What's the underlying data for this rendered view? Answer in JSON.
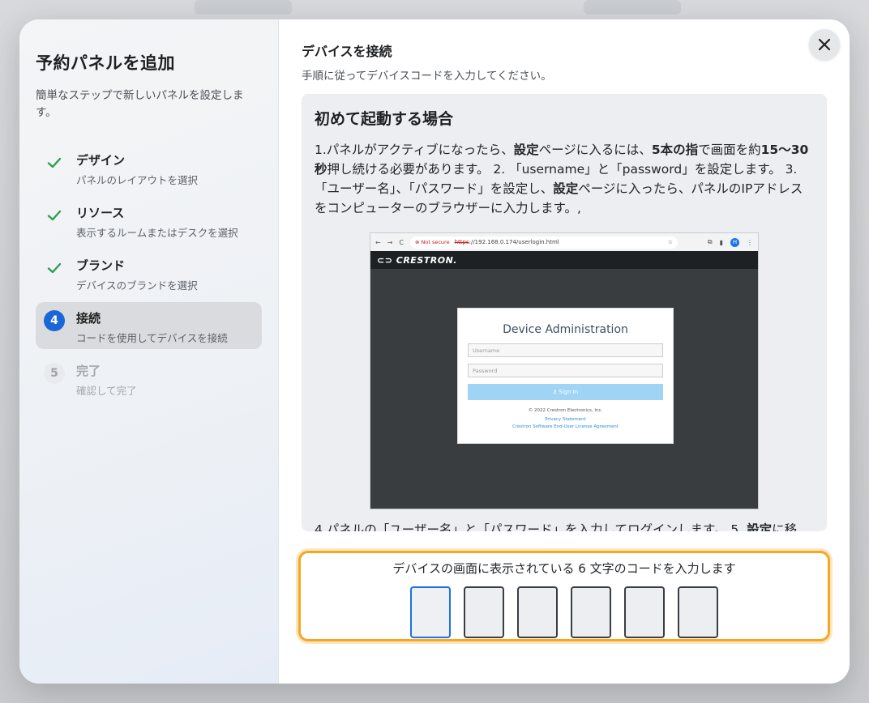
{
  "modal": {
    "sidebar": {
      "title": "予約パネルを追加",
      "subtitle": "簡単なステップで新しいパネルを設定します。",
      "steps": [
        {
          "name": "デザイン",
          "desc": "パネルのレイアウトを選択",
          "status": "done",
          "number": "1"
        },
        {
          "name": "リソース",
          "desc": "表示するルームまたはデスクを選択",
          "status": "done",
          "number": "2"
        },
        {
          "name": "ブランド",
          "desc": "デバイスのブランドを選択",
          "status": "done",
          "number": "3"
        },
        {
          "name": "接続",
          "desc": "コードを使用してデバイスを接続",
          "status": "current",
          "number": "4"
        },
        {
          "name": "完了",
          "desc": "確認して完了",
          "status": "pending",
          "number": "5"
        }
      ]
    },
    "main": {
      "title": "デバイスを接続",
      "subtitle": "手順に従ってデバイスコードを入力してください。",
      "close_icon": "close-icon",
      "instructions": {
        "heading": "初めて起動する場合",
        "p1_a": "1.パネルがアクティブになったら、",
        "p1_b": "設定",
        "p1_c": "ページに入るには、",
        "p1_d": "5本の指",
        "p1_e": "で画面を約",
        "p1_f": "15〜30秒",
        "p1_g": "押し続ける必要があります。 2. 「username」と「password」を設定します。 3. 「ユーザー名」、「パスワード」を設定し、",
        "p1_h": "設定",
        "p1_i": "ページに入ったら、パネルのIPアドレスをコンピューターのブラウザーに入力します。,",
        "p2_a": "4.パネルの「ユーザー名」と「パスワード」を入力してログインします。 5. ",
        "p2_b": "設定",
        "p2_c": "に移"
      },
      "screenshot": {
        "not_secure": "Not secure",
        "url_scheme": "https",
        "url_rest": "://192.168.0.174/userlogin.html",
        "brand": "CRESTRON.",
        "avatar": "H",
        "panel_title": "Device Administration",
        "username_placeholder": "Username",
        "password_placeholder": "Password",
        "sign_in": "Sign In",
        "copyright": "© 2022 Crestron Electronics, Inc.",
        "privacy": "Privacy Statement",
        "eula": "Crestron Software End-User License Agreement"
      },
      "code": {
        "prompt": "デバイスの画面に表示されている 6 文字のコードを入力します",
        "cells": [
          "",
          "",
          "",
          "",
          "",
          ""
        ]
      }
    }
  },
  "colors": {
    "accent_blue": "#1a66d6",
    "check_green": "#2e9e4f",
    "highlight_orange": "#f5a623"
  }
}
